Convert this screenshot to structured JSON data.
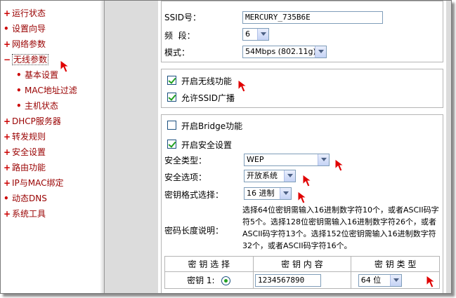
{
  "sidebar": {
    "items": [
      {
        "mark": "+",
        "label": "运行状态"
      },
      {
        "mark": "•",
        "label": "设置向导"
      },
      {
        "mark": "+",
        "label": "网络参数"
      },
      {
        "mark": "−",
        "label": "无线参数"
      },
      {
        "mark": "+",
        "label": "DHCP服务器"
      },
      {
        "mark": "+",
        "label": "转发规则"
      },
      {
        "mark": "+",
        "label": "安全设置"
      },
      {
        "mark": "+",
        "label": "路由功能"
      },
      {
        "mark": "+",
        "label": "IP与MAC绑定"
      },
      {
        "mark": "•",
        "label": "动态DNS"
      },
      {
        "mark": "+",
        "label": "系统工具"
      }
    ],
    "subitems": [
      {
        "label": "基本设置"
      },
      {
        "label": "MAC地址过滤"
      },
      {
        "label": "主机状态"
      }
    ]
  },
  "basic": {
    "ssid_label": "SSID号：",
    "ssid_value": "MERCURY_735B6E",
    "channel_label": "频  段：",
    "channel_value": "6",
    "mode_label": "模式：",
    "mode_value": "54Mbps (802.11g)"
  },
  "options": {
    "enable_wireless": "开启无线功能",
    "allow_ssid_broadcast": "允许SSID广播"
  },
  "security": {
    "enable_bridge": "开启Bridge功能",
    "enable_security": "开启安全设置",
    "type_label": "安全类型：",
    "type_value": "WEP",
    "option_label": "安全选项：",
    "option_value": "开放系统",
    "key_format_label": "密钥格式选择：",
    "key_format_value": "16 进制",
    "key_length_label": "密码长度说明：",
    "key_length_desc": "选择64位密钥需输入16进制数字符10个，或者ASCII码字符5个。选择128位密钥需输入16进制数字符26个，或者ASCII码字符13个。选择152位密钥需输入16进制数字符32个，或者ASCII码字符16个。"
  },
  "key_table": {
    "headers": [
      "密 钥 选 择",
      "密 钥 内 容",
      "密 钥 类 型"
    ],
    "rows": [
      {
        "label": "密钥 1:",
        "value": "1234567890",
        "type": "64 位"
      }
    ]
  }
}
